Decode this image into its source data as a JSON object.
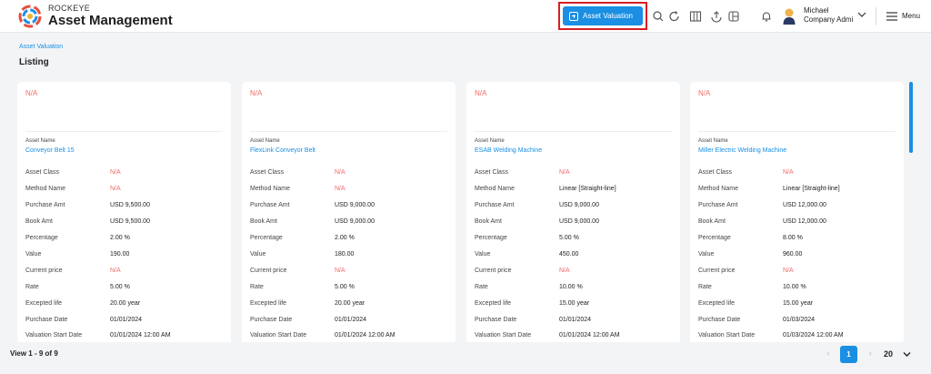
{
  "header": {
    "brand_top": "ROCKEYE",
    "brand_main": "Asset Management",
    "asset_valuation_button": "Asset Valuation",
    "icons": [
      "search-icon",
      "refresh-icon",
      "columns-icon",
      "upload-icon",
      "layout-icon",
      "bell-icon"
    ],
    "user_name": "Michael",
    "user_role": "Company Admi",
    "menu_label": "Menu"
  },
  "breadcrumb": "Asset Valuation",
  "page_title": "Listing",
  "field_labels": {
    "asset_name": "Asset Name",
    "asset_class": "Asset Class",
    "method_name": "Method Name",
    "purchase_amt": "Purchase Amt",
    "book_amt": "Book Amt",
    "percentage": "Percentage",
    "value": "Value",
    "current_price": "Current price",
    "rate": "Rate",
    "expected_life": "Excepted life",
    "purchase_date": "Purchase Date",
    "valuation_start_date": "Valuation Start Date"
  },
  "cards": [
    {
      "top_status": "N/A",
      "asset_name": "Conveyor Belt 15",
      "asset_class": "N/A",
      "method_name": "N/A",
      "purchase_amt": "USD 9,500.00",
      "book_amt": "USD 9,500.00",
      "percentage": "2.00 %",
      "value": "190.00",
      "current_price": "N/A",
      "rate": "5.00 %",
      "expected_life": "20.00 year",
      "purchase_date": "01/01/2024",
      "valuation_start_date": "01/01/2024 12:00 AM"
    },
    {
      "top_status": "N/A",
      "asset_name": "FlexLink Conveyor Belt",
      "asset_class": "N/A",
      "method_name": "N/A",
      "purchase_amt": "USD 9,000.00",
      "book_amt": "USD 9,000.00",
      "percentage": "2.00 %",
      "value": "180.00",
      "current_price": "N/A",
      "rate": "5.00 %",
      "expected_life": "20.00 year",
      "purchase_date": "01/01/2024",
      "valuation_start_date": "01/01/2024 12:00 AM"
    },
    {
      "top_status": "N/A",
      "asset_name": "ESAB Welding Machine",
      "asset_class": "N/A",
      "method_name": "Linear [Straight-line]",
      "purchase_amt": "USD 9,000.00",
      "book_amt": "USD 9,000.00",
      "percentage": "5.00 %",
      "value": "450.00",
      "current_price": "N/A",
      "rate": "10.00 %",
      "expected_life": "15.00 year",
      "purchase_date": "01/01/2024",
      "valuation_start_date": "01/01/2024 12:00 AM"
    },
    {
      "top_status": "N/A",
      "asset_name": "Miller Electric Welding Machine",
      "asset_class": "N/A",
      "method_name": "Linear [Straight-line]",
      "purchase_amt": "USD 12,000.00",
      "book_amt": "USD 12,000.00",
      "percentage": "8.00 %",
      "value": "960.00",
      "current_price": "N/A",
      "rate": "10.00 %",
      "expected_life": "15.00 year",
      "purchase_date": "01/03/2024",
      "valuation_start_date": "01/03/2024 12:00 AM"
    }
  ],
  "footer": {
    "view_count": "View 1 - 9 of 9",
    "current_page": "1",
    "page_size": "20"
  },
  "colors": {
    "accent": "#1a8fe3",
    "na_text": "#f06a6a",
    "highlight_border": "#d61f26",
    "background": "#f3f4f6"
  }
}
